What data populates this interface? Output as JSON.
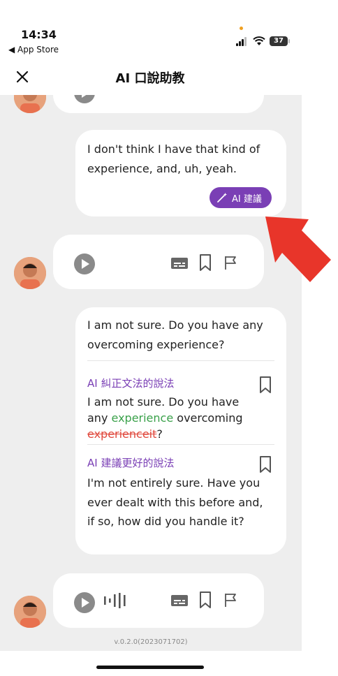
{
  "status_bar": {
    "time": "14:34",
    "back_label": "◀ App Store",
    "battery": "37"
  },
  "nav": {
    "title": "AI 口說助教"
  },
  "messages": {
    "user_reply": {
      "text": "I don't think I have that kind of experience, and, uh, yeah.",
      "ai_button": "AI 建議"
    },
    "suggestion": {
      "original": "I am not sure. Do you have any overcoming experience?",
      "grammar_label": "AI 糾正文法的說法",
      "grammar_line1": "I am not sure. Do you have",
      "grammar_any": "any ",
      "grammar_insert": "experience",
      "grammar_mid": " overcoming",
      "grammar_deleted": "experienceit",
      "grammar_end": "?",
      "better_label": "AI 建議更好的說法",
      "better_text": "I'm not entirely sure. Have you ever dealt with this before and, if so, how did you handle it?"
    }
  },
  "footer": {
    "version": "v.0.2.0(2023071702)"
  },
  "colors": {
    "accent": "#7a3fb5",
    "insert": "#3aa14a",
    "delete": "#e0483c",
    "arrow": "#e8352a"
  }
}
